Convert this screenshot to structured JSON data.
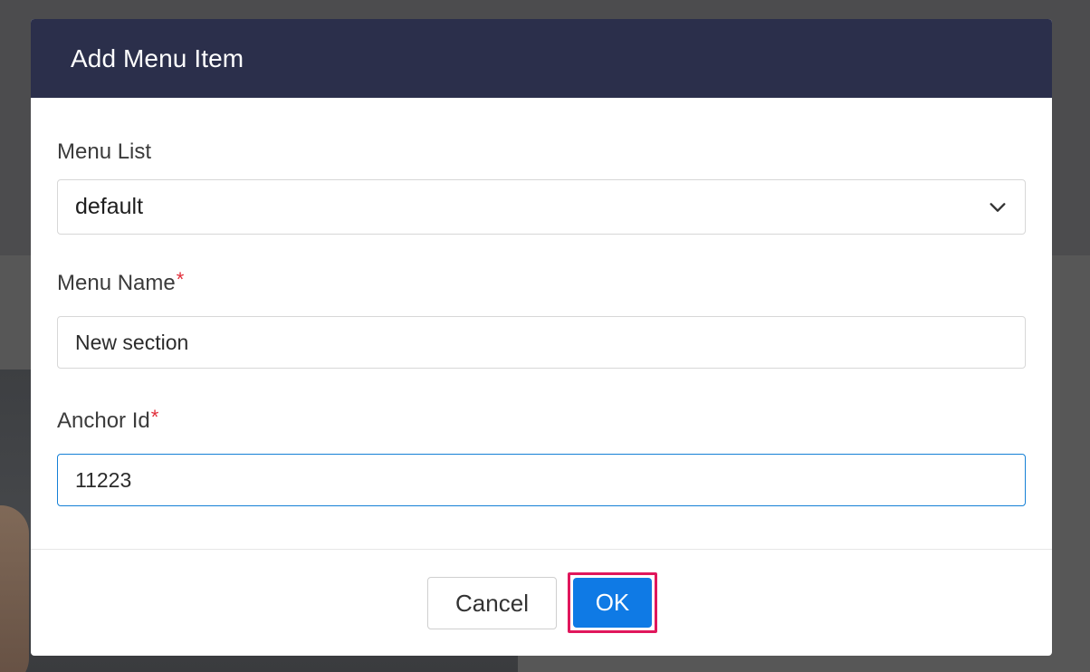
{
  "dialog": {
    "title": "Add Menu Item"
  },
  "fields": {
    "menu_list": {
      "label": "Menu List",
      "selected": "default"
    },
    "menu_name": {
      "label": "Menu Name",
      "required_mark": "*",
      "value": "New section"
    },
    "anchor_id": {
      "label": "Anchor Id",
      "required_mark": "*",
      "value": "11223"
    }
  },
  "footer": {
    "cancel_label": "Cancel",
    "ok_label": "OK"
  },
  "colors": {
    "header_bg": "#2b2f4b",
    "primary": "#0f7ae5",
    "highlight": "#e0175c",
    "required": "#e12d39",
    "focus_border": "#1580d6"
  },
  "icons": {
    "dropdown": "chevron-down-icon"
  }
}
